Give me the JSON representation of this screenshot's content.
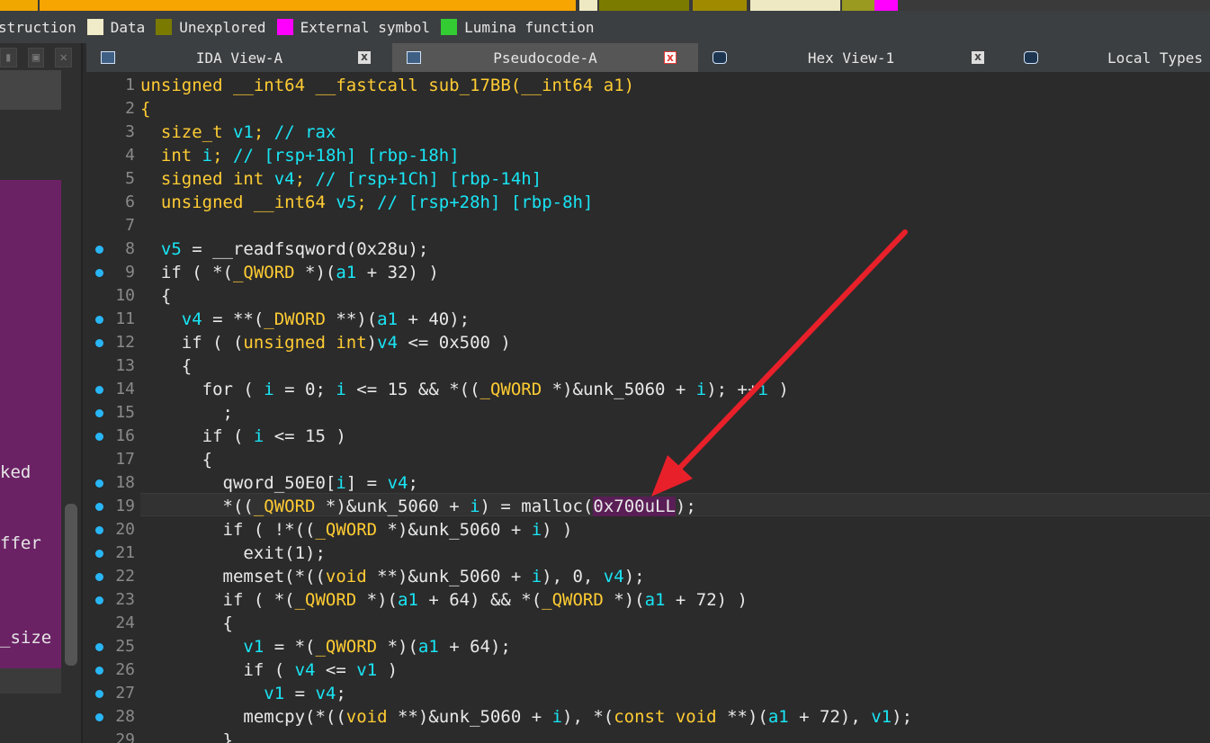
{
  "legend": [
    {
      "label": "struction",
      "color": "#e8b8f8",
      "swatch": false
    },
    {
      "label": "Data",
      "color": "#f0ebc8",
      "swatch": true
    },
    {
      "label": "Unexplored",
      "color": "#7a7a00",
      "swatch": true
    },
    {
      "label": "External symbol",
      "color": "#ff00ff",
      "swatch": true
    },
    {
      "label": "Lumina function",
      "color": "#33cc33",
      "swatch": true
    }
  ],
  "left_panel": {
    "text1": "ked",
    "text2": "ffer",
    "text3": "_size"
  },
  "tabs": [
    {
      "label": "IDA View-A",
      "active": false,
      "close": "x"
    },
    {
      "label": "Pseudocode-A",
      "active": true,
      "close": "x"
    },
    {
      "label": "Hex View-1",
      "active": false,
      "close": "x"
    },
    {
      "label": "Local Types",
      "active": false,
      "close": ""
    }
  ],
  "code": {
    "highlighted_line": 19,
    "lines": [
      {
        "n": "1",
        "dot": false,
        "html": "<span class='kw'>unsigned __int64 __fastcall sub_17BB(__int64 a1)</span>"
      },
      {
        "n": "2",
        "dot": false,
        "html": "<span class='kw'>{</span>"
      },
      {
        "n": "3",
        "dot": false,
        "html": "  <span class='kw'>size_t</span> <span class='var'>v1</span><span class='kw'>;</span> <span class='cm'>// rax</span>"
      },
      {
        "n": "4",
        "dot": false,
        "html": "  <span class='kw'>int</span> <span class='var'>i</span><span class='kw'>;</span> <span class='cm'>// [rsp+18h] [rbp-18h]</span>"
      },
      {
        "n": "5",
        "dot": false,
        "html": "  <span class='kw'>signed int</span> <span class='var'>v4</span><span class='kw'>;</span> <span class='cm'>// [rsp+1Ch] [rbp-14h]</span>"
      },
      {
        "n": "6",
        "dot": false,
        "html": "  <span class='kw'>unsigned __int64</span> <span class='var'>v5</span><span class='kw'>;</span> <span class='cm'>// [rsp+28h] [rbp-8h]</span>"
      },
      {
        "n": "7",
        "dot": false,
        "html": ""
      },
      {
        "n": "8",
        "dot": true,
        "html": "  <span class='var'>v5</span> = __readfsqword(0x28u);"
      },
      {
        "n": "9",
        "dot": true,
        "html": "  if ( *(<span class='kw'>_QWORD</span> *)(<span class='var'>a1</span> + 32) )"
      },
      {
        "n": "10",
        "dot": false,
        "html": "  {"
      },
      {
        "n": "11",
        "dot": true,
        "html": "    <span class='var'>v4</span> = **(<span class='kw'>_DWORD</span> **)(<span class='var'>a1</span> + 40);"
      },
      {
        "n": "12",
        "dot": true,
        "html": "    if ( (<span class='kw'>unsigned int</span>)<span class='var'>v4</span> &lt;= 0x500 )"
      },
      {
        "n": "13",
        "dot": false,
        "html": "    {"
      },
      {
        "n": "14",
        "dot": true,
        "html": "      for ( <span class='var'>i</span> = 0; <span class='var'>i</span> &lt;= 15 &amp;&amp; *((<span class='kw'>_QWORD</span> *)&amp;unk_5060 + <span class='var'>i</span>); ++<span class='var'>i</span> )"
      },
      {
        "n": "15",
        "dot": true,
        "html": "        ;"
      },
      {
        "n": "16",
        "dot": true,
        "html": "      if ( <span class='var'>i</span> &lt;= 15 )"
      },
      {
        "n": "17",
        "dot": false,
        "html": "      {"
      },
      {
        "n": "18",
        "dot": true,
        "html": "        qword_50E0[<span class='var'>i</span>] = <span class='var'>v4</span>;"
      },
      {
        "n": "19",
        "dot": true,
        "html": "        *((<span class='kw'>_QWORD</span> *)&amp;unk_5060 + <span class='var'>i</span>) = malloc(<span class='hl'>0x700uLL</span>);"
      },
      {
        "n": "20",
        "dot": true,
        "html": "        if ( !*((<span class='kw'>_QWORD</span> *)&amp;unk_5060 + <span class='var'>i</span>) )"
      },
      {
        "n": "21",
        "dot": true,
        "html": "          exit(1);"
      },
      {
        "n": "22",
        "dot": true,
        "html": "        memset(*((<span class='kw'>void</span> **)&amp;unk_5060 + <span class='var'>i</span>), 0, <span class='var'>v4</span>);"
      },
      {
        "n": "23",
        "dot": true,
        "html": "        if ( *(<span class='kw'>_QWORD</span> *)(<span class='var'>a1</span> + 64) &amp;&amp; *(<span class='kw'>_QWORD</span> *)(<span class='var'>a1</span> + 72) )"
      },
      {
        "n": "24",
        "dot": false,
        "html": "        {"
      },
      {
        "n": "25",
        "dot": true,
        "html": "          <span class='var'>v1</span> = *(<span class='kw'>_QWORD</span> *)(<span class='var'>a1</span> + 64);"
      },
      {
        "n": "26",
        "dot": true,
        "html": "          if ( <span class='var'>v4</span> &lt;= <span class='var'>v1</span> )"
      },
      {
        "n": "27",
        "dot": true,
        "html": "            <span class='var'>v1</span> = <span class='var'>v4</span>;"
      },
      {
        "n": "28",
        "dot": true,
        "html": "          memcpy(*((<span class='kw'>void</span> **)&amp;unk_5060 + <span class='var'>i</span>), *(<span class='kw'>const void</span> **)(<span class='var'>a1</span> + 72), <span class='var'>v1</span>);"
      },
      {
        "n": "29",
        "dot": false,
        "html": "        }"
      }
    ]
  },
  "colors": {
    "keyword": "#ffcc33",
    "variable": "#19e5f5",
    "highlight": "#5a1e56",
    "arrow": "#e8202a",
    "breakpoint_dot": "#29b6f6"
  }
}
